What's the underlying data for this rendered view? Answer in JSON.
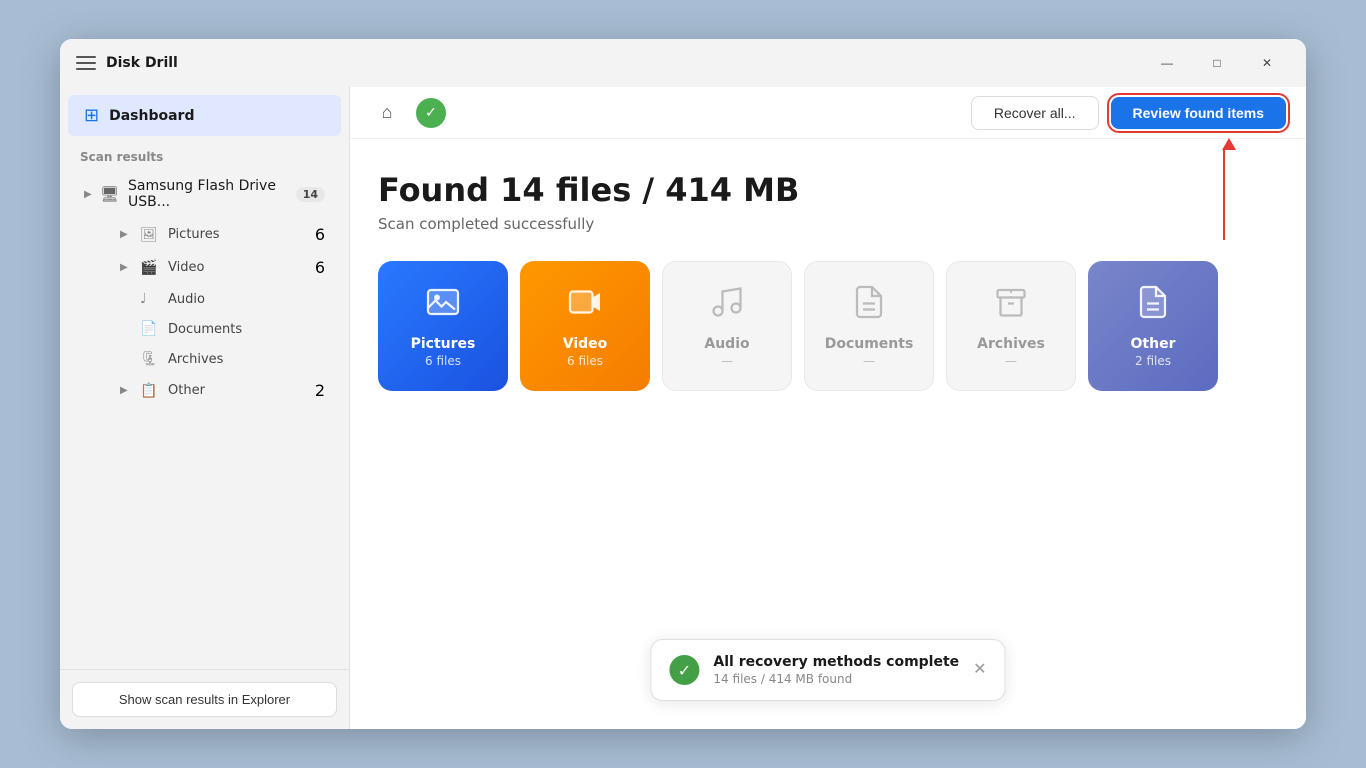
{
  "window": {
    "title": "Disk Drill",
    "controls": {
      "minimize": "—",
      "maximize": "□",
      "close": "✕"
    }
  },
  "sidebar": {
    "dashboard_label": "Dashboard",
    "scan_results_label": "Scan results",
    "items": [
      {
        "id": "samsung",
        "label": "Samsung Flash Drive USB...",
        "badge": "14",
        "has_chevron": true,
        "icon": "💾"
      }
    ],
    "sub_items": [
      {
        "id": "pictures",
        "label": "Pictures",
        "badge": "6",
        "icon": "🖼"
      },
      {
        "id": "video",
        "label": "Video",
        "badge": "6",
        "icon": "🎬"
      },
      {
        "id": "audio",
        "label": "Audio",
        "badge": "",
        "icon": "🎵"
      },
      {
        "id": "documents",
        "label": "Documents",
        "badge": "",
        "icon": "📄"
      },
      {
        "id": "archives",
        "label": "Archives",
        "badge": "",
        "icon": "🗜"
      },
      {
        "id": "other",
        "label": "Other",
        "badge": "2",
        "icon": "📋"
      }
    ],
    "show_explorer_btn": "Show scan results in Explorer"
  },
  "toolbar": {
    "recover_btn": "Recover all...",
    "review_btn": "Review found items"
  },
  "content": {
    "found_title": "Found 14 files / 414 MB",
    "scan_status": "Scan completed successfully",
    "cards": [
      {
        "id": "pictures",
        "label": "Pictures",
        "count": "6 files",
        "type": "active-blue",
        "icon": "🖼"
      },
      {
        "id": "video",
        "label": "Video",
        "count": "6 files",
        "type": "active-orange",
        "icon": "🎬"
      },
      {
        "id": "audio",
        "label": "Audio",
        "count": "—",
        "type": "inactive",
        "icon": "🎵"
      },
      {
        "id": "documents",
        "label": "Documents",
        "count": "—",
        "type": "inactive",
        "icon": "📄"
      },
      {
        "id": "archives",
        "label": "Archives",
        "count": "—",
        "type": "inactive",
        "icon": "🗜"
      },
      {
        "id": "other",
        "label": "Other",
        "count": "2 files",
        "type": "active-purple",
        "icon": "📋"
      }
    ]
  },
  "toast": {
    "title": "All recovery methods complete",
    "subtitle": "14 files / 414 MB found",
    "close": "✕"
  }
}
